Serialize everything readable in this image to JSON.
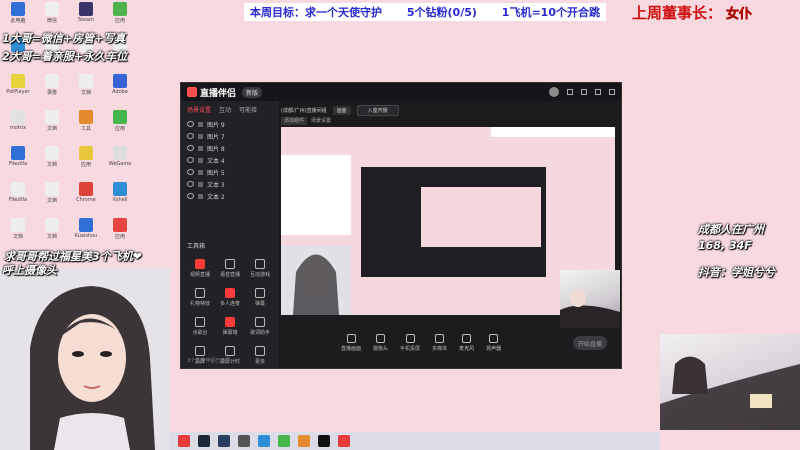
{
  "banner": {
    "goal": "本周目标：求一个天使守护",
    "fans": "5个钻粉(0/5)",
    "rule": "1飞机=10个开合跳"
  },
  "top_right": {
    "label": "上周董事长：",
    "name": "女仆"
  },
  "notes": {
    "line1": "1大哥=微信+房管+写真",
    "line2": "2大哥=着亲服+永久车位"
  },
  "desktop_icons": [
    {
      "label": "此电脑",
      "color": "#2f6fd6"
    },
    {
      "label": "微信",
      "color": "#f0f0f0"
    },
    {
      "label": "Steam",
      "color": "#39346a"
    },
    {
      "label": "应用",
      "color": "#4bb34b"
    },
    {
      "label": "网络",
      "color": "#2f8fd6"
    },
    {
      "label": "文档",
      "color": "#eeeeee"
    },
    {
      "label": "文档",
      "color": "#eeeeee"
    },
    {
      "label": "文件",
      "color": "#eeeeee"
    },
    {
      "label": "PotPlayer",
      "color": "#e8d23a"
    },
    {
      "label": "录像",
      "color": "#eeeeee"
    },
    {
      "label": "文档",
      "color": "#eeeeee"
    },
    {
      "label": "Adobe",
      "color": "#3a63d6"
    },
    {
      "label": "motrix",
      "color": "#e2e2e2"
    },
    {
      "label": "文档",
      "color": "#eeeeee"
    },
    {
      "label": "工具",
      "color": "#e68a2e"
    },
    {
      "label": "应用",
      "color": "#45b74a"
    },
    {
      "label": "Filezilla",
      "color": "#2f6fd6"
    },
    {
      "label": "文档",
      "color": "#eeeeee"
    },
    {
      "label": "应用",
      "color": "#e6c83a"
    },
    {
      "label": "WeGame",
      "color": "#dddddd"
    },
    {
      "label": "Filezilla",
      "color": "#eeeeee"
    },
    {
      "label": "文档",
      "color": "#eeeeee"
    },
    {
      "label": "Chrome",
      "color": "#db4437"
    },
    {
      "label": "Xshell",
      "color": "#2f8fd6"
    },
    {
      "label": "文档",
      "color": "#eeeeee"
    },
    {
      "label": "文档",
      "color": "#eeeeee"
    },
    {
      "label": "Kuaishou",
      "color": "#2f6fd6"
    },
    {
      "label": "应用",
      "color": "#e84343"
    }
  ],
  "app": {
    "title": "直播伴侣",
    "version": "新版",
    "tabs": [
      "场景设置",
      "互动",
      "可能接"
    ],
    "layers": [
      "图片 9",
      "图片 7",
      "图片 8",
      "文本 4",
      "图片 5",
      "文本 3",
      "文本 2"
    ],
    "tools_title": "工具箱",
    "tools": [
      "视频直播",
      "语音直播",
      "互动游戏",
      "礼物特效",
      "多人连麦",
      "弹幕",
      "点歌台",
      "弹幕墙",
      "歌词助手",
      "投屏",
      "投屏计时",
      "更多"
    ],
    "footer": "3个直播伴侣已运行",
    "scene": "(成都/广州)直播间组",
    "scene_pills": [
      "画面",
      "入座开播"
    ],
    "scene_row2": [
      "添加组件",
      "场景设置"
    ],
    "bottom": [
      "直播画面",
      "摄像头",
      "手机投屏",
      "多媒体",
      "麦克风",
      "扬声器"
    ],
    "live_button": "开始直播"
  },
  "webcam_text": "求哥哥帮过福星美3个飞机❤",
  "webcam_sub": "呼上摄像头",
  "city": {
    "line1": "成都人在广州",
    "line2": "168, 34F"
  },
  "douyin": "抖音：学姐兮兮",
  "taskbar": {
    "icons": [
      {
        "name": "weibo-icon",
        "color": "#e63a3a"
      },
      {
        "name": "steam-icon",
        "color": "#1b2838"
      },
      {
        "name": "steam-client-icon",
        "color": "#2a3f5f"
      },
      {
        "name": "settings-icon",
        "color": "#555555"
      },
      {
        "name": "xshell-icon",
        "color": "#2f8fd6"
      },
      {
        "name": "player-icon",
        "color": "#45b74a"
      },
      {
        "name": "app-icon",
        "color": "#e68a2e"
      },
      {
        "name": "yellow-app-icon",
        "color": "#111111"
      },
      {
        "name": "live-icon",
        "color": "#e63a3a"
      }
    ]
  }
}
